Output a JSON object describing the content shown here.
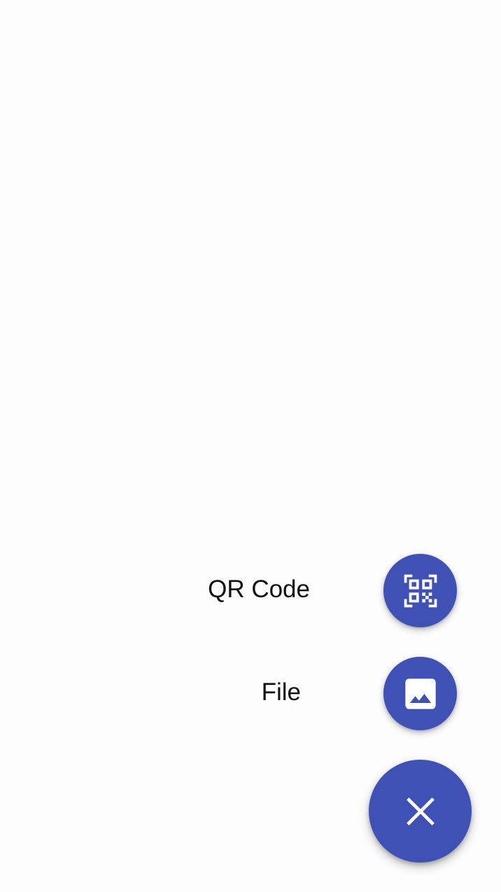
{
  "colors": {
    "background": "#fdfdfd",
    "fab": "#3f51b5",
    "icon": "#ffffff",
    "label_text": "#111111"
  },
  "speed_dial": {
    "actions": [
      {
        "label": "QR Code",
        "icon": "qr-code-icon"
      },
      {
        "label": "File",
        "icon": "image-icon"
      }
    ],
    "main_button": {
      "icon": "close-icon",
      "state": "expanded"
    }
  }
}
